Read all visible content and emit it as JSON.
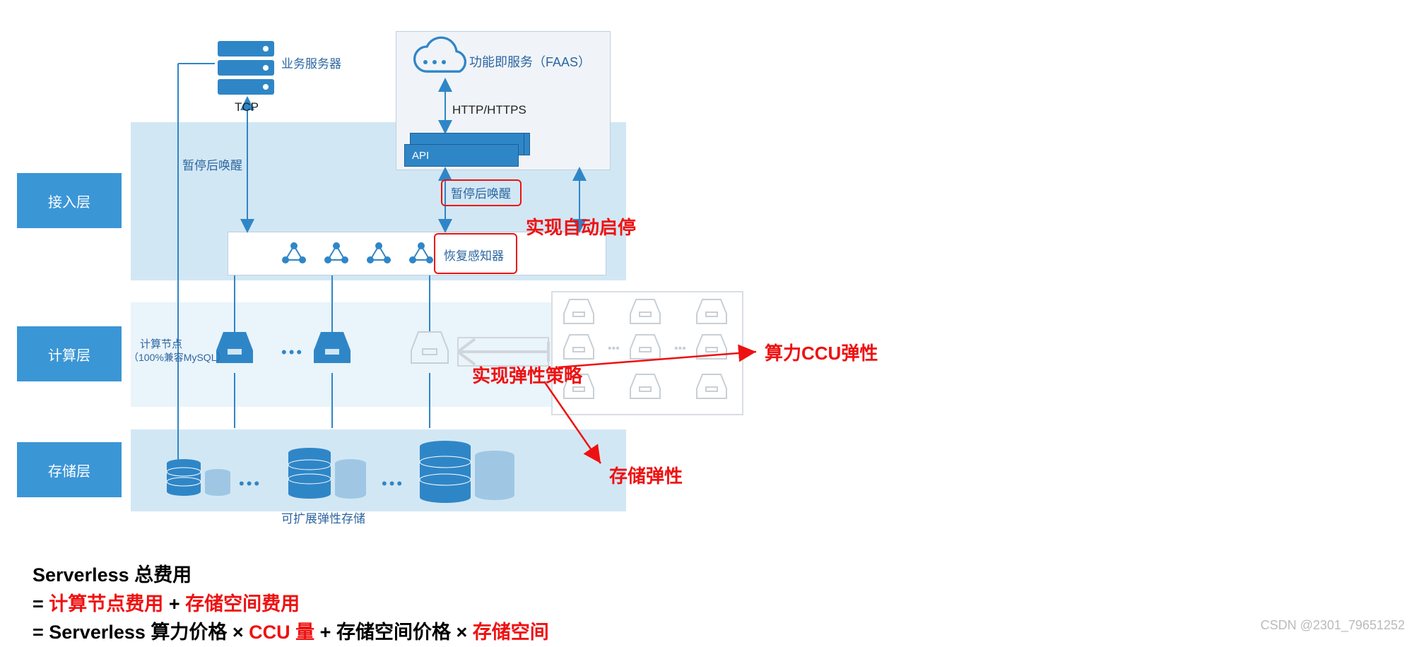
{
  "labels": {
    "layer_access": "接入层",
    "layer_compute": "计算层",
    "layer_storage": "存储层",
    "biz_server": "业务服务器",
    "tcp": "TCP",
    "faas": "功能即服务（FAAS）",
    "http": "HTTP/HTTPS",
    "api": "API",
    "pause_resume": "暂停后唤醒",
    "pause_resume2": "暂停后唤醒",
    "recovery_sense": "恢复感知器",
    "compute_node_l1": "计算节点",
    "compute_node_l2": "（100%兼容MySQL）",
    "storage_scale": "可扩展弹性存储",
    "dots": "•••",
    "watermark": "CSDN @2301_79651252"
  },
  "annotations": {
    "auto_start_stop": "实现自动启停",
    "elastic_strategy": "实现弹性策略",
    "ccu_elastic": "算力CCU弹性",
    "storage_elastic": "存储弹性"
  },
  "formula": {
    "line1": "Serverless 总费用",
    "eq": "=",
    "compute_fee": "计算节点费用",
    "plus": " + ",
    "storage_fee": "存储空间费用",
    "prefix2": "= Serverless 算力价格 × ",
    "ccu": "CCU 量",
    "mid2": " + 存储空间价格 × ",
    "storage_space": "存储空间"
  }
}
